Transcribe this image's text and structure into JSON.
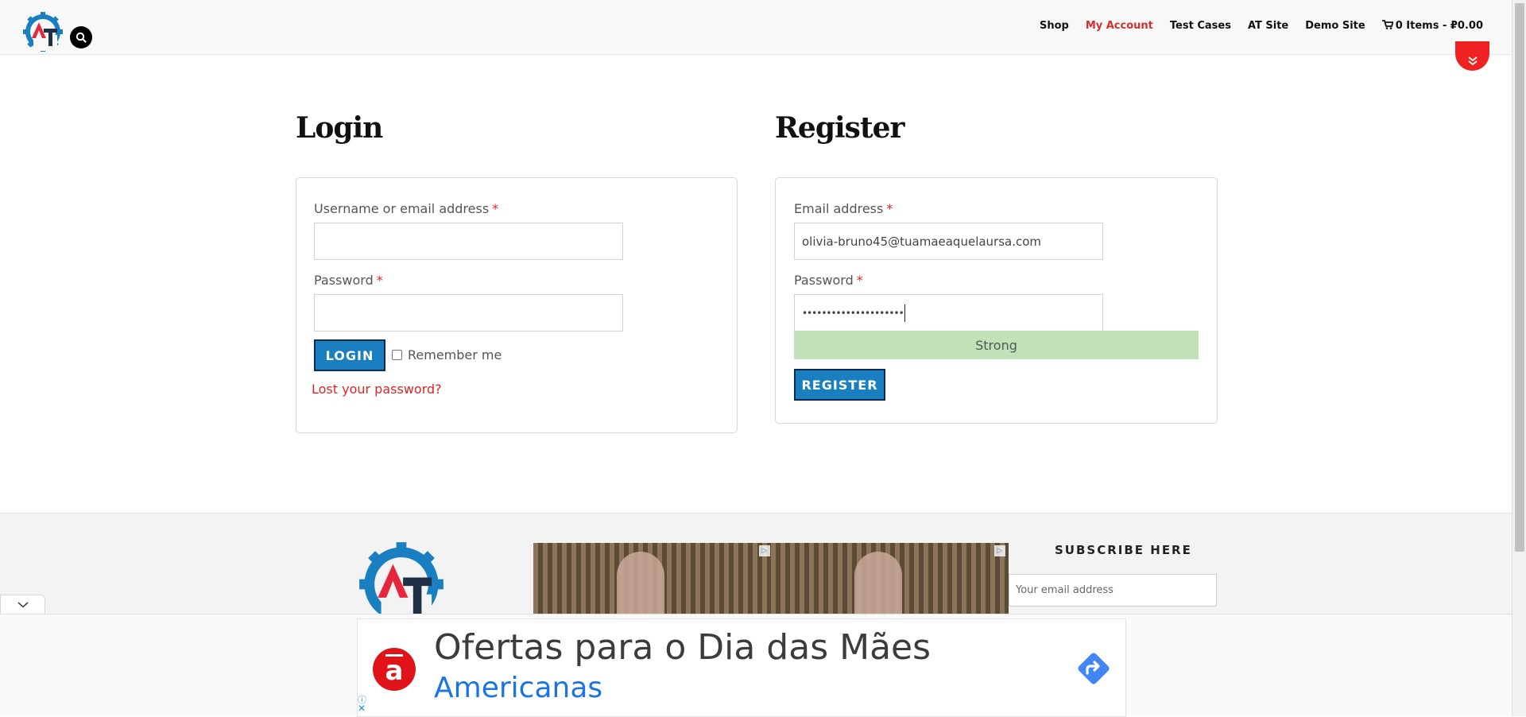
{
  "header": {
    "nav": [
      {
        "label": "Shop"
      },
      {
        "label": "My Account",
        "active": true
      },
      {
        "label": "Test Cases"
      },
      {
        "label": "AT Site"
      },
      {
        "label": "Demo Site"
      }
    ],
    "cart_label": "0 Items - ₽0.00"
  },
  "login": {
    "title": "Login",
    "username_label": "Username or email address",
    "username_value": "",
    "password_label": "Password",
    "password_value": "",
    "required_mark": "*",
    "button": "LOGIN",
    "remember_label": "Remember me",
    "remember_checked": false,
    "lost_password": "Lost your password?"
  },
  "register": {
    "title": "Register",
    "email_label": "Email address",
    "email_value": "olivia-bruno45@tuamaeaquelaursa.com",
    "password_label": "Password",
    "password_masked": "•••••••••••••••••••••",
    "required_mark": "*",
    "strength": "Strong",
    "button": "REGISTER"
  },
  "footer": {
    "subscribe_title": "SUBSCRIBE HERE",
    "subscribe_placeholder": "Your email address"
  },
  "bottom_ad": {
    "headline": "Ofertas para o Dia das Mães",
    "advertiser": "Americanas",
    "brand_glyph": "a",
    "info_glyph": "ⓘ",
    "close_glyph": "✕"
  },
  "colors": {
    "accent_red": "#e02424",
    "button_blue": "#1a7fc1",
    "strength_green": "#c1e1b9",
    "ad_link_blue": "#1a73e8"
  }
}
